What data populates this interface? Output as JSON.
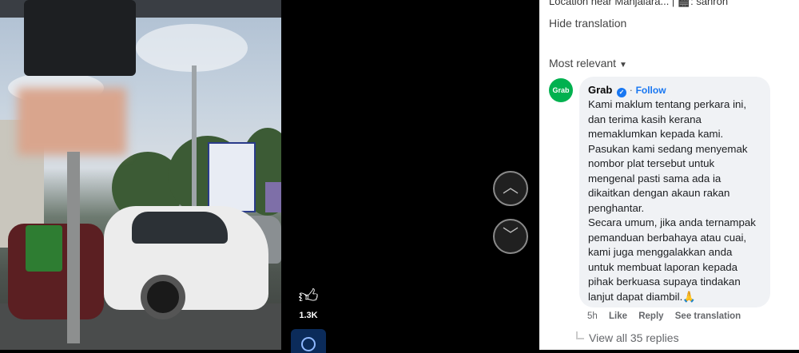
{
  "video": {
    "like_count": "1.3K",
    "like_icon": "thumbs-up-icon",
    "prev_icon": "chevron-up-icon",
    "next_icon": "chevron-down-icon"
  },
  "panel": {
    "location_line": "Location near Manjalara... | 🎬: sahron",
    "hide_translation": "Hide translation",
    "sort_label": "Most relevant",
    "comment": {
      "avatar_text": "Grab",
      "author": "Grab",
      "follow": "Follow",
      "text": "Kami maklum tentang perkara ini,\ndan terima kasih kerana\nmemaklumkan kepada kami.\nPasukan kami sedang menyemak\nnombor plat tersebut untuk\nmengenal pasti sama ada ia\ndikaitkan dengan akaun rakan\npenghantar.\nSecara umum, jika anda ternampak\npemanduan berbahaya atau cuai,\nkami juga menggalakkan anda\nuntuk membuat laporan kepada\npihak berkuasa supaya tindakan\nlanjut dapat diambil.🙏",
      "time": "5h",
      "like": "Like",
      "reply": "Reply",
      "see_translation": "See translation",
      "view_replies": "View all 35 replies"
    }
  },
  "colors": {
    "brand_green": "#00b14f",
    "link_blue": "#1877f2"
  }
}
